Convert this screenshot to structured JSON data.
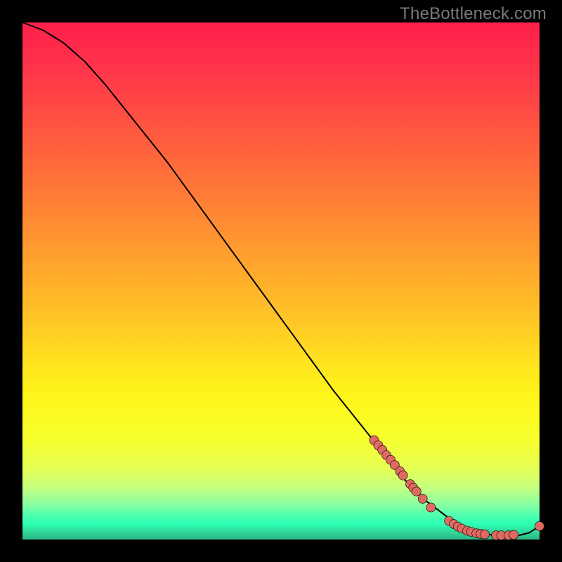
{
  "watermark": "TheBottleneck.com",
  "chart_data": {
    "type": "line",
    "title": "",
    "xlabel": "",
    "ylabel": "",
    "xlim": [
      0,
      100
    ],
    "ylim": [
      0,
      100
    ],
    "grid": false,
    "legend": false,
    "series": [
      {
        "name": "curve",
        "x": [
          0,
          4,
          8,
          12,
          16,
          20,
          24,
          28,
          32,
          36,
          40,
          44,
          48,
          52,
          56,
          60,
          64,
          68,
          72,
          74,
          78,
          80,
          82,
          84,
          86,
          88,
          90,
          92,
          94,
          96,
          98,
          100
        ],
        "y": [
          100,
          98.5,
          96,
          92.5,
          88,
          83,
          78,
          73,
          67.5,
          62,
          56.5,
          51,
          45.5,
          40,
          34.5,
          29,
          24,
          19,
          14,
          11.5,
          7.5,
          6,
          4.5,
          3.2,
          2.2,
          1.5,
          1.0,
          0.8,
          0.7,
          0.8,
          1.3,
          2.6
        ]
      }
    ],
    "dots": [
      {
        "x": 68.0,
        "y": 19.2
      },
      {
        "x": 68.8,
        "y": 18.2
      },
      {
        "x": 69.6,
        "y": 17.3
      },
      {
        "x": 70.4,
        "y": 16.3
      },
      {
        "x": 71.2,
        "y": 15.4
      },
      {
        "x": 72.0,
        "y": 14.4
      },
      {
        "x": 73.0,
        "y": 13.2
      },
      {
        "x": 73.6,
        "y": 12.4
      },
      {
        "x": 75.0,
        "y": 10.7
      },
      {
        "x": 75.6,
        "y": 10.0
      },
      {
        "x": 76.2,
        "y": 9.3
      },
      {
        "x": 77.4,
        "y": 7.9
      },
      {
        "x": 79.0,
        "y": 6.2
      },
      {
        "x": 82.5,
        "y": 3.6
      },
      {
        "x": 83.4,
        "y": 3.0
      },
      {
        "x": 84.2,
        "y": 2.5
      },
      {
        "x": 85.0,
        "y": 2.1
      },
      {
        "x": 86.0,
        "y": 1.7
      },
      {
        "x": 86.8,
        "y": 1.5
      },
      {
        "x": 87.8,
        "y": 1.2
      },
      {
        "x": 88.6,
        "y": 1.1
      },
      {
        "x": 89.4,
        "y": 1.0
      },
      {
        "x": 91.6,
        "y": 0.8
      },
      {
        "x": 92.6,
        "y": 0.8
      },
      {
        "x": 94.0,
        "y": 0.8
      },
      {
        "x": 95.0,
        "y": 0.9
      },
      {
        "x": 100.0,
        "y": 2.6
      }
    ],
    "dot_color": "#e06a62",
    "background_gradient": {
      "top": "#ff1f4b",
      "mid": "#ffd11f",
      "bottom": "#2bb885"
    }
  }
}
